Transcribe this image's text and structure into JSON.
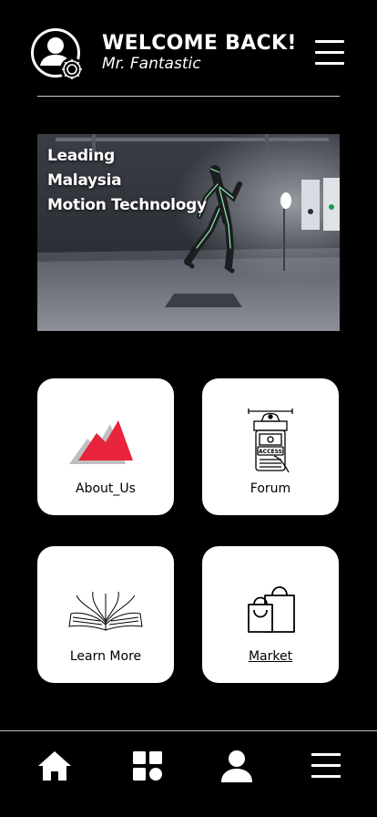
{
  "header": {
    "title": "WELCOME BACK!",
    "username": "Mr. Fantastic",
    "avatar_icon": "user-settings-icon",
    "menu_icon": "hamburger-menu-icon"
  },
  "hero": {
    "caption_lines": [
      "Leading",
      "Malaysia",
      "Motion Technology"
    ],
    "image_subject": "motion-capture-performer"
  },
  "cards": [
    {
      "label": "About_Us",
      "icon": "mountain-icon"
    },
    {
      "label": "Forum",
      "icon": "access-badge-icon"
    },
    {
      "label": "Learn More",
      "icon": "open-book-icon"
    },
    {
      "label": "Market",
      "icon": "shopping-bags-icon"
    }
  ],
  "bottom_nav": [
    {
      "icon": "home-icon"
    },
    {
      "icon": "grid-icon"
    },
    {
      "icon": "profile-icon"
    },
    {
      "icon": "menu-icon"
    }
  ],
  "colors": {
    "background": "#000000",
    "card": "#ffffff",
    "accent_red": "#e8243c",
    "text": "#ffffff"
  }
}
